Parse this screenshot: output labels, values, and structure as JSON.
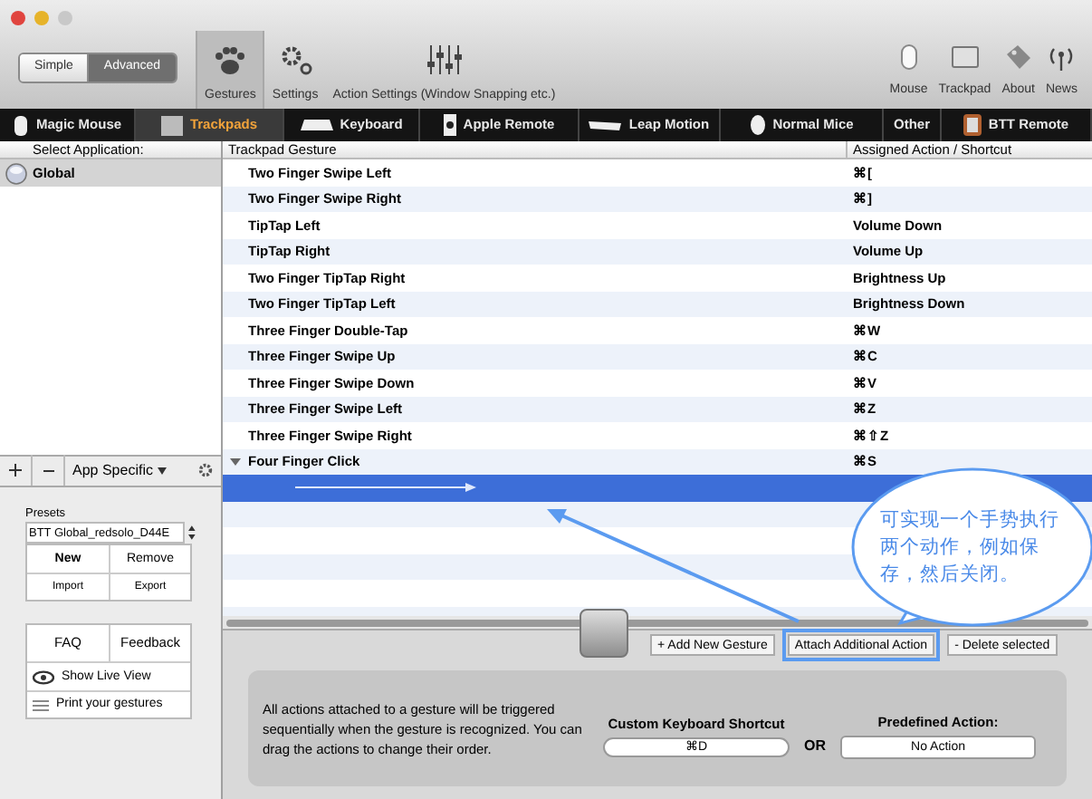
{
  "toolbar": {
    "mode_switch": [
      {
        "label": "Simple",
        "selected": false
      },
      {
        "label": "Advanced",
        "selected": true
      }
    ],
    "tools": [
      {
        "label": "Gestures",
        "selected": true
      },
      {
        "label": "Settings",
        "selected": false
      },
      {
        "label": "Action Settings (Window Snapping etc.)",
        "selected": false
      }
    ],
    "device_buttons": [
      "Mouse",
      "Trackpad",
      "About",
      "News"
    ]
  },
  "device_tabs": [
    {
      "label": "Magic Mouse",
      "selected": false
    },
    {
      "label": "Trackpads",
      "selected": true
    },
    {
      "label": "Keyboard",
      "selected": false
    },
    {
      "label": "Apple Remote",
      "selected": false
    },
    {
      "label": "Leap Motion",
      "selected": false
    },
    {
      "label": "Normal Mice",
      "selected": false
    },
    {
      "label": "Other",
      "selected": false
    },
    {
      "label": "BTT Remote",
      "selected": false
    }
  ],
  "sidebar": {
    "header": "Select Application:",
    "apps": [
      {
        "name": "Global",
        "selected": true
      }
    ],
    "scope": "App Specific",
    "presets": {
      "label": "Presets",
      "value": "BTT Global_redsolo_D44E",
      "buttons": [
        "New",
        "Remove",
        "Import",
        "Export"
      ]
    },
    "help_buttons": [
      "FAQ",
      "Feedback"
    ],
    "links": [
      "Show Live View",
      "Print your gestures"
    ]
  },
  "table": {
    "columns": [
      "Trackpad Gesture",
      "Assigned Action / Shortcut"
    ],
    "rows": [
      {
        "gesture": "Two Finger Swipe Left",
        "shortcut": "⌘[",
        "selected": false
      },
      {
        "gesture": "Two Finger Swipe Right",
        "shortcut": "⌘]",
        "selected": false
      },
      {
        "gesture": "TipTap Left",
        "shortcut": "Volume Down",
        "selected": false
      },
      {
        "gesture": "TipTap Right",
        "shortcut": "Volume Up",
        "selected": false
      },
      {
        "gesture": "Two Finger TipTap Right",
        "shortcut": "Brightness Up",
        "selected": false
      },
      {
        "gesture": "Two Finger TipTap Left",
        "shortcut": "Brightness Down",
        "selected": false
      },
      {
        "gesture": "Three Finger Double-Tap",
        "shortcut": "⌘W",
        "selected": false
      },
      {
        "gesture": "Three Finger Swipe Up",
        "shortcut": "⌘C",
        "selected": false
      },
      {
        "gesture": "Three Finger Swipe Down",
        "shortcut": "⌘V",
        "selected": false
      },
      {
        "gesture": "Three Finger Swipe Left",
        "shortcut": "⌘Z",
        "selected": false
      },
      {
        "gesture": "Three Finger Swipe Right",
        "shortcut": "⌘⇧Z",
        "selected": false
      },
      {
        "gesture": "Four Finger Click",
        "shortcut": "⌘S",
        "selected": false,
        "expanded": true,
        "children": [
          {
            "selected": true
          }
        ]
      }
    ]
  },
  "bottom_panel": {
    "buttons": [
      "+ Add New Gesture",
      "Attach Additional Action",
      "- Delete selected"
    ],
    "info": "All actions attached to a gesture will be triggered sequentially when the gesture is recognized. You can drag the actions to change their order.",
    "shortcut": {
      "label": "Custom Keyboard Shortcut",
      "value": "⌘D"
    },
    "or_label": "OR",
    "predefined": {
      "label": "Predefined Action:",
      "value": "No Action"
    }
  },
  "annotation": {
    "lines": [
      "可实现一个手势执行",
      "两个动作，例如保",
      "存，然后关闭。"
    ]
  }
}
